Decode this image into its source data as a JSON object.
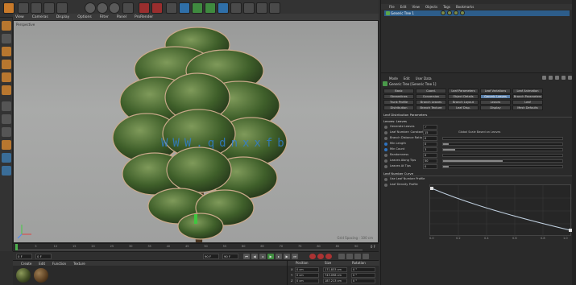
{
  "viewport": {
    "menu": [
      "View",
      "Cameras",
      "Display",
      "Options",
      "Filter",
      "Panel",
      "ProRender"
    ],
    "label": "Perspective",
    "info": "Grid Spacing : 100 cm"
  },
  "watermark": "WWW.qdnxxfb",
  "timeline": {
    "ticks": [
      "0",
      "5",
      "10",
      "15",
      "20",
      "25",
      "30",
      "35",
      "40",
      "45",
      "50",
      "55",
      "60",
      "65",
      "70",
      "75",
      "80",
      "85",
      "90"
    ],
    "end_label": "0 F"
  },
  "playback": {
    "start": "0 F",
    "current": "0 F",
    "end": "90 F",
    "max": "90 F"
  },
  "materials": {
    "menu": [
      "Create",
      "Edit",
      "Function",
      "Texture"
    ],
    "items": [
      "Leaf",
      "Bark"
    ]
  },
  "coordinates": {
    "headers": [
      "Position",
      "Size",
      "Rotation"
    ],
    "rows": [
      {
        "axis": "X",
        "pos": "0 cm",
        "size": "171.833 cm",
        "rot": "0 °"
      },
      {
        "axis": "Y",
        "pos": "0 cm",
        "size": "743.098 cm",
        "rot": "0 °"
      },
      {
        "axis": "Z",
        "pos": "0 cm",
        "size": "187.213 cm",
        "rot": "0 °"
      }
    ]
  },
  "object_manager": {
    "menu": [
      "File",
      "Edit",
      "View",
      "Objects",
      "Tags",
      "Bookmarks"
    ],
    "selected_object": "Generic Tree 1"
  },
  "attribute_manager": {
    "menu": [
      "Mode",
      "Edit",
      "User Data"
    ],
    "title": "Generic Tree [Generic Tree 1]",
    "tabs": [
      "Basic",
      "Coord.",
      "Leaf Parameters",
      "Leaf Variations",
      "Leaf Animation",
      "Streamlines",
      "Conversion",
      "Object Details",
      "Branch Parameters",
      "Generic Leaves",
      "Trunk Profile",
      "Branch Leaves",
      "Branch Layout",
      "Leaves",
      "Leaf",
      "Distribution",
      "Branch Texture",
      "Leaf Disp.",
      "Display",
      "Mesh Defaults",
      "Other"
    ],
    "active_tab": "Generic Leaves",
    "section_1": "Leaf Distribution Parameters",
    "section_1b": "Leaves: Leaves",
    "params": [
      {
        "label": "Generate Leaves",
        "value": "✓",
        "fill": 0
      },
      {
        "label": "Leaf Number: Constant",
        "value": "15",
        "fill": 0.08
      },
      {
        "label": "Branch Distance Ratio",
        "value": "0",
        "fill": 0
      },
      {
        "label": "Min Length",
        "value": "0",
        "fill": 0.05
      },
      {
        "label": "Min Count",
        "value": "3",
        "fill": 0.1
      },
      {
        "label": "Randomness",
        "value": "0",
        "fill": 0
      },
      {
        "label": "Leaves Along Tips",
        "value": "50",
        "fill": 0.5
      },
      {
        "label": "Leaves At Tips",
        "value": "0",
        "fill": 0.05
      }
    ],
    "global_scale_label": "Global Scale Based on Leaves",
    "curve_head": "Leaf Number Curve",
    "curve_opts": [
      "Use Leaf Number Profile",
      "Leaf Density Profile"
    ],
    "curve_x_labels": [
      "0.0",
      "0.2",
      "0.4",
      "0.6",
      "0.8",
      "1.0"
    ]
  }
}
